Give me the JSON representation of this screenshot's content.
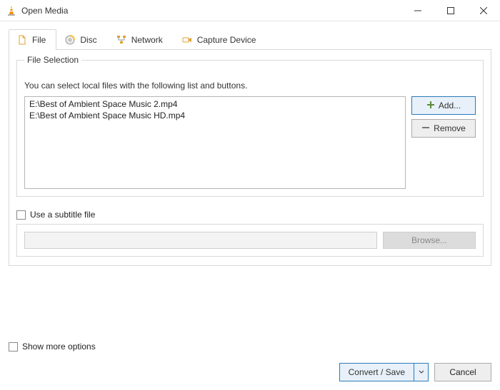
{
  "window": {
    "title": "Open Media"
  },
  "tabs": {
    "file": "File",
    "disc": "Disc",
    "network": "Network",
    "capture": "Capture Device"
  },
  "fileSelection": {
    "legend": "File Selection",
    "hint": "You can select local files with the following list and buttons.",
    "files": [
      "E:\\Best of Ambient Space Music 2.mp4",
      "E:\\Best of Ambient Space Music HD.mp4"
    ],
    "add": "Add...",
    "remove": "Remove"
  },
  "subtitle": {
    "label": "Use a subtitle file",
    "browse": "Browse..."
  },
  "showMore": "Show more options",
  "footer": {
    "convert": "Convert / Save",
    "cancel": "Cancel"
  }
}
